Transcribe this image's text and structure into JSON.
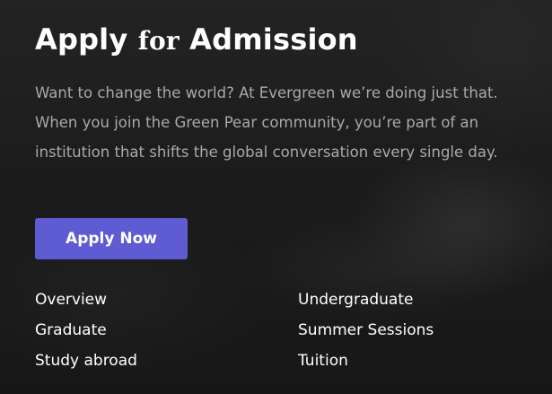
{
  "hero": {
    "title_start": "Apply ",
    "title_for": "for",
    "title_end": " Admission",
    "description": "Want to change the world? At Evergreen we’re doing just that. When you join the Green Pear community, you’re part of an institution that shifts the global conversation every single day.",
    "cta_label": "Apply Now",
    "cta_color": "#5f5bd2"
  },
  "links": [
    {
      "label": "Overview"
    },
    {
      "label": "Undergraduate"
    },
    {
      "label": "Graduate"
    },
    {
      "label": "Summer Sessions"
    },
    {
      "label": "Study abroad"
    },
    {
      "label": "Tuition"
    }
  ]
}
